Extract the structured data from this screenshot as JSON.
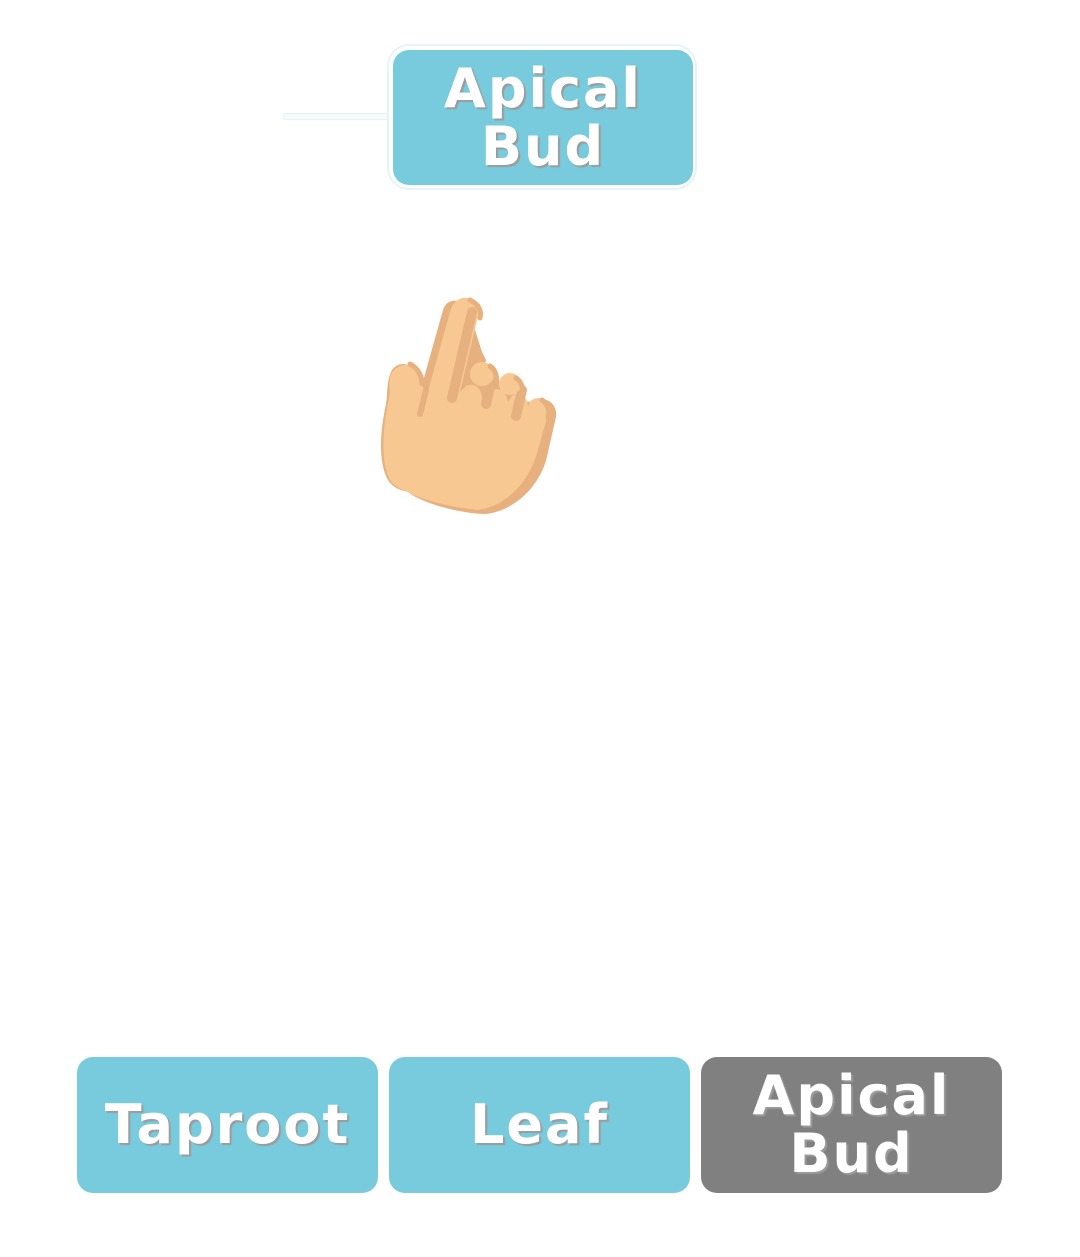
{
  "dragged_label": {
    "text": "Apical\nBud"
  },
  "pointer": {
    "icon": "pointing-hand-icon"
  },
  "choices": [
    {
      "label": "Taproot",
      "state": "available"
    },
    {
      "label": "Leaf",
      "state": "available"
    },
    {
      "label": "Apical\nBud",
      "state": "used"
    }
  ],
  "colors": {
    "label_fill": "#78cbdc",
    "used_fill": "#808080",
    "text": "#ffffff",
    "skin": "#f7c892",
    "skin_shade": "#e6b07f"
  }
}
